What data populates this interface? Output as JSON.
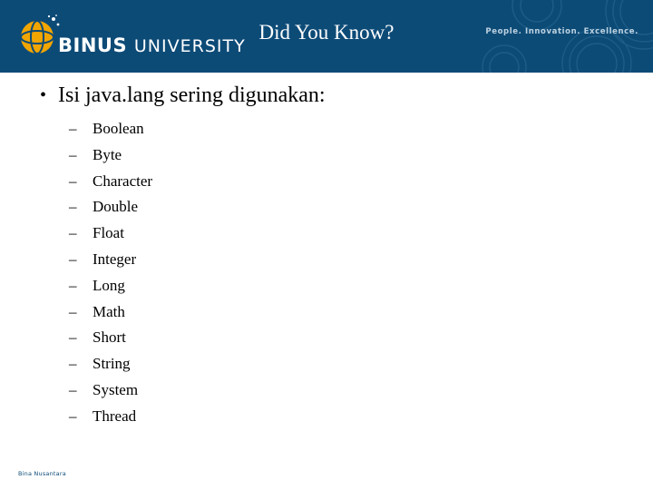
{
  "header": {
    "title": "Did You Know?",
    "logo_name": "BINUS",
    "logo_suffix": "UNIVERSITY",
    "tagline": "People. Innovation. Excellence.",
    "band_color": "#0d4b77",
    "logo_accent_color": "#f0a500"
  },
  "content": {
    "bullet": "Isi java.lang sering digunakan:",
    "items": [
      "Boolean",
      "Byte",
      "Character",
      "Double",
      "Float",
      "Integer",
      "Long",
      "Math",
      "Short",
      "String",
      "System",
      "Thread"
    ]
  },
  "footer": {
    "text": "Bina Nusantara"
  }
}
